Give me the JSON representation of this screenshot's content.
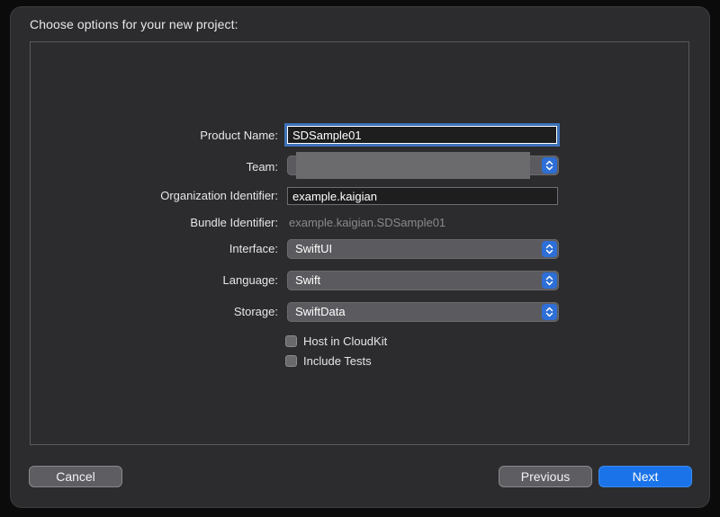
{
  "dialog": {
    "title": "Choose options for your new project:"
  },
  "form": {
    "product_name": {
      "label": "Product Name:",
      "value": "SDSample01"
    },
    "team": {
      "label": "Team:",
      "value": ""
    },
    "organization_identifier": {
      "label": "Organization Identifier:",
      "value": "example.kaigian"
    },
    "bundle_identifier": {
      "label": "Bundle Identifier:",
      "value": "example.kaigian.SDSample01"
    },
    "interface": {
      "label": "Interface:",
      "value": "SwiftUI"
    },
    "language": {
      "label": "Language:",
      "value": "Swift"
    },
    "storage": {
      "label": "Storage:",
      "value": "SwiftData"
    },
    "host_in_cloudkit": {
      "label": "Host in CloudKit",
      "checked": false
    },
    "include_tests": {
      "label": "Include Tests",
      "checked": false
    }
  },
  "footer": {
    "cancel_label": "Cancel",
    "previous_label": "Previous",
    "next_label": "Next"
  },
  "colors": {
    "accent": "#1a73e8",
    "background": "#2c2c2e",
    "popup": "#5b5b5f"
  }
}
